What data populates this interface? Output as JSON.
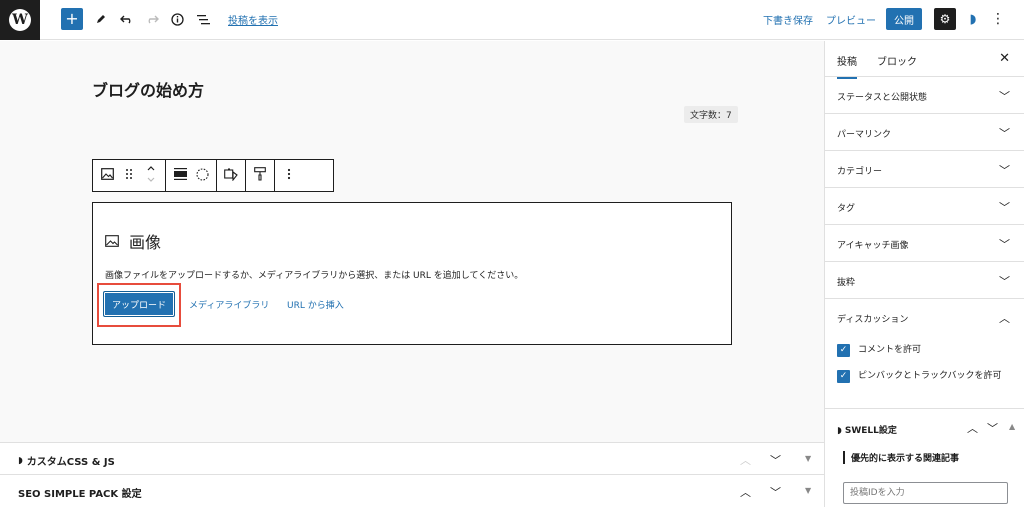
{
  "toolbar": {
    "logo": "W",
    "add_label": "+",
    "view_post": "投稿を表示",
    "save_draft": "下書き保存",
    "preview": "プレビュー",
    "publish": "公開",
    "settings_glyph": "⚙",
    "swell_glyph": "◗",
    "more_glyph": "⋮",
    "icons": [
      "pencil-icon",
      "undo-icon",
      "redo-icon",
      "info-icon",
      "list-view-icon"
    ]
  },
  "editor": {
    "title": "ブログの始め方",
    "char_count": "文字数：7",
    "image_block": {
      "heading": "画像",
      "description": "画像ファイルをアップロードするか、メディアライブラリから選択、または URL を追加してください。",
      "upload_label": "アップロード",
      "media_library_label": "メディアライブラリ",
      "insert_url_label": "URL から挿入"
    }
  },
  "metaboxes": [
    {
      "title": "カスタムCSS & JS"
    },
    {
      "title": "SEO SIMPLE PACK 設定"
    }
  ],
  "sidebar": {
    "tabs": [
      "投稿",
      "ブロック"
    ],
    "panels": [
      "ステータスと公開状態",
      "パーマリンク",
      "カテゴリー",
      "タグ",
      "アイキャッチ画像",
      "抜粋"
    ],
    "discussion": {
      "title": "ディスカッション",
      "allow_comments": "コメントを許可",
      "allow_pingbacks": "ピンバックとトラックバックを許可"
    },
    "swell": {
      "title": "SWELL設定",
      "subheading": "優先的に表示する関連記事",
      "input_placeholder": "投稿IDを入力"
    }
  },
  "colors": {
    "accent": "#2271b1",
    "dark": "#1e1e1e",
    "highlight": "#e74c3c"
  }
}
